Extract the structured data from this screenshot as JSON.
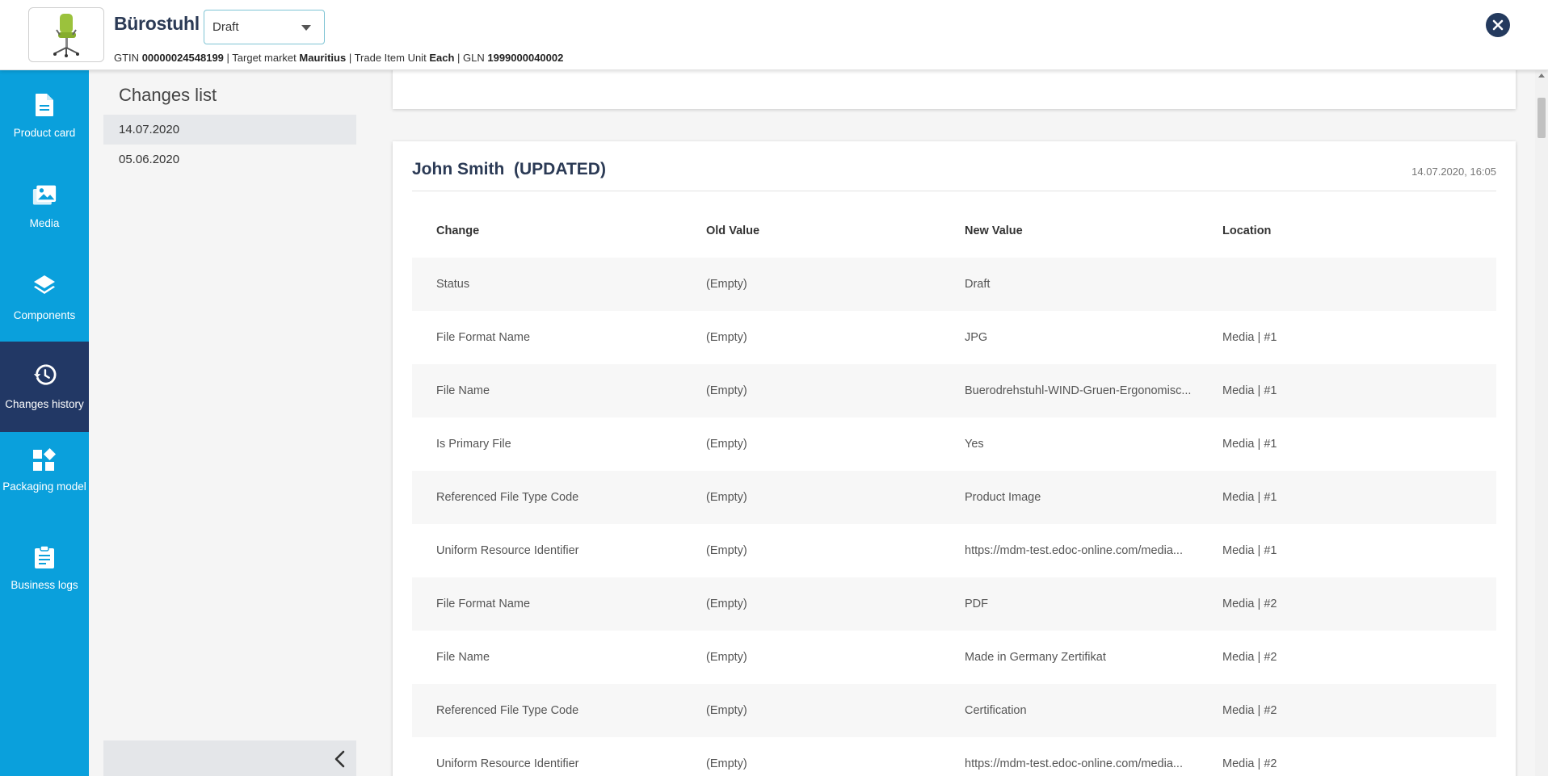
{
  "header": {
    "product_title": "Bürostuhl",
    "status_selected": "Draft",
    "meta": {
      "gtin_label": "GTIN",
      "gtin_value": "00000024548199",
      "target_market_label": "| Target market",
      "target_market_value": "Mauritius",
      "unit_label": "| Trade Item Unit",
      "unit_value": "Each",
      "gln_label": "| GLN",
      "gln_value": "1999000040002"
    }
  },
  "nav": {
    "items": [
      {
        "label": "Product card",
        "icon": "document-icon"
      },
      {
        "label": "Media",
        "icon": "images-icon"
      },
      {
        "label": "Components",
        "icon": "layers-icon"
      },
      {
        "label": "Changes history",
        "icon": "history-icon"
      },
      {
        "label": "Packaging model",
        "icon": "widgets-icon"
      },
      {
        "label": "Business logs",
        "icon": "clipboard-icon"
      }
    ]
  },
  "changes_panel": {
    "title": "Changes list",
    "dates": [
      "14.07.2020",
      "05.06.2020"
    ]
  },
  "change_entry": {
    "author": "John Smith  (UPDATED)",
    "timestamp": "14.07.2020, 16:05",
    "columns": [
      "Change",
      "Old Value",
      "New Value",
      "Location"
    ],
    "rows": [
      [
        "Status",
        "(Empty)",
        "Draft",
        ""
      ],
      [
        "File Format Name",
        "(Empty)",
        "JPG",
        "Media | #1"
      ],
      [
        "File Name",
        "(Empty)",
        "Buerodrehstuhl-WIND-Gruen-Ergonomisc...",
        "Media | #1"
      ],
      [
        "Is Primary File",
        "(Empty)",
        "Yes",
        "Media | #1"
      ],
      [
        "Referenced File Type Code",
        "(Empty)",
        "Product Image",
        "Media | #1"
      ],
      [
        "Uniform Resource Identifier",
        "(Empty)",
        "https://mdm-test.edoc-online.com/media...",
        "Media | #1"
      ],
      [
        "File Format Name",
        "(Empty)",
        "PDF",
        "Media | #2"
      ],
      [
        "File Name",
        "(Empty)",
        "Made in Germany Zertifikat",
        "Media | #2"
      ],
      [
        "Referenced File Type Code",
        "(Empty)",
        "Certification",
        "Media | #2"
      ],
      [
        "Uniform Resource Identifier",
        "(Empty)",
        "https://mdm-test.edoc-online.com/media...",
        "Media | #2"
      ]
    ]
  },
  "colors": {
    "nav_bg": "#0aa0dc",
    "nav_active": "#223865",
    "title": "#2b3a55"
  }
}
